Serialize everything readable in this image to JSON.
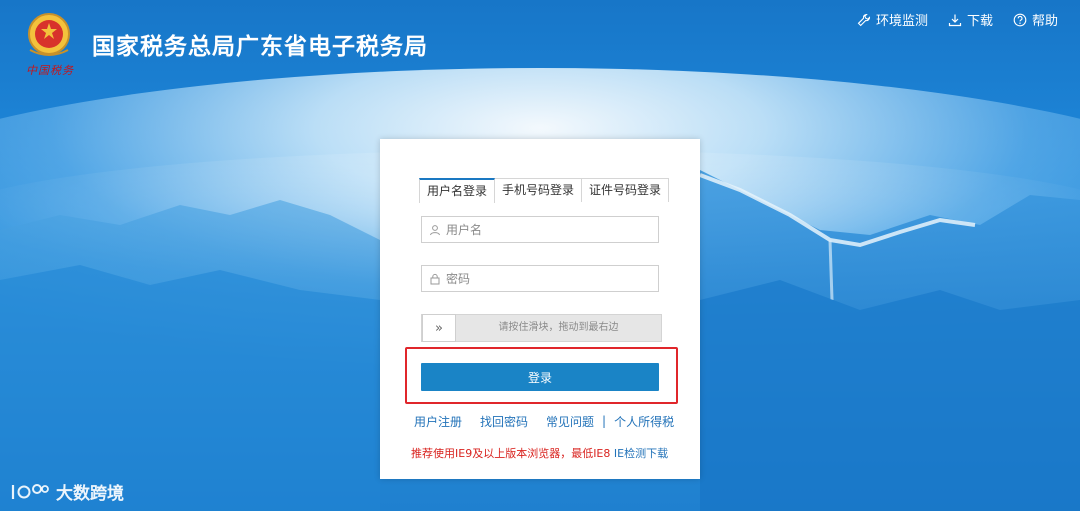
{
  "header": {
    "title": "国家税务总局广东省电子税务局",
    "seal_text": "中国税务",
    "links": [
      {
        "label": "环境监测",
        "icon": "wrench-icon"
      },
      {
        "label": "下载",
        "icon": "download-icon"
      },
      {
        "label": "帮助",
        "icon": "help-icon"
      }
    ]
  },
  "login": {
    "tabs": [
      {
        "label": "用户名登录",
        "active": true
      },
      {
        "label": "手机号码登录",
        "active": false
      },
      {
        "label": "证件号码登录",
        "active": false
      }
    ],
    "username_placeholder": "用户名",
    "password_placeholder": "密码",
    "slider_handle": "»",
    "slider_text": "请按住滑块，拖动到最右边",
    "login_button": "登录",
    "links": {
      "register": "用户注册",
      "recover": "找回密码",
      "faq": "常见问题",
      "separator": "|",
      "iit": "个人所得税"
    },
    "notice": {
      "text": "推荐使用IE9及以上版本浏览器，最低IE8",
      "link": "IE检测下载"
    }
  },
  "watermark": "大数跨境",
  "colors": {
    "accent": "#1a84c6",
    "highlight": "#e0262b",
    "notice": "#d9231f",
    "link": "#2373b9"
  }
}
